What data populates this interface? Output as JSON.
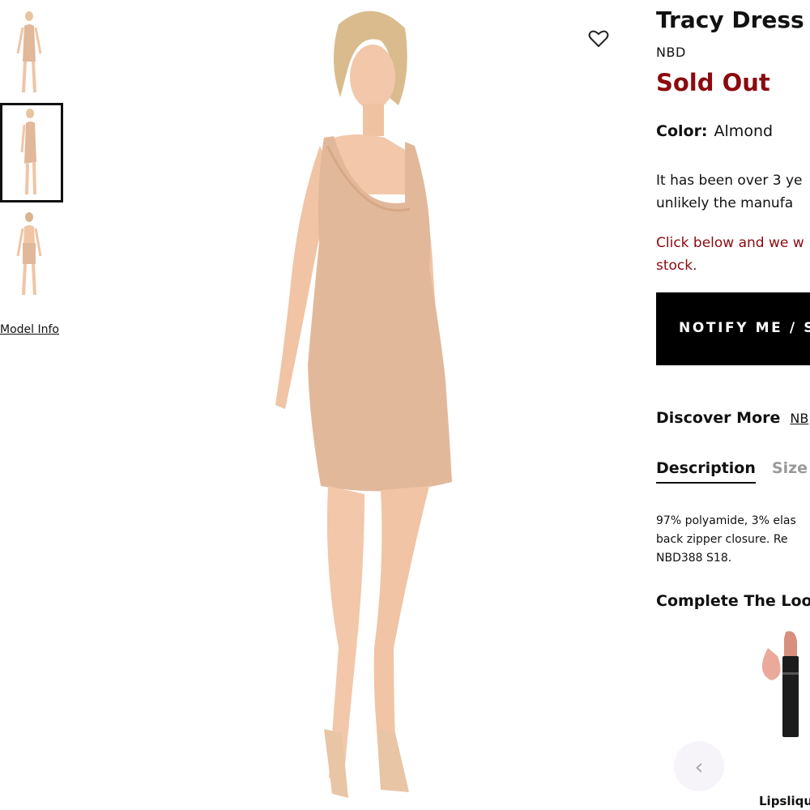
{
  "gallery": {
    "model_info_label": "Model Info"
  },
  "product": {
    "title": "Tracy Dress",
    "brand": "NBD",
    "status": "Sold Out",
    "color_label": "Color:",
    "color_value": "Almond",
    "notice_line1": "It has been over 3 ye",
    "notice_line2": "unlikely the manufa",
    "notice_red_line1": "Click below and we w",
    "notice_red_line2": "stock.",
    "notify_button": "NOTIFY ME / S",
    "discover_label": "Discover More",
    "discover_link": "NB",
    "tabs": [
      "Description",
      "Size"
    ],
    "description_line1": "97% polyamide, 3% elas",
    "description_line2": "back zipper closure. Re",
    "description_line3": "NBD388 S18.",
    "complete_look_label": "Complete The Loo",
    "complete_look_item": "Lipsliqu",
    "carousel_prev_icon": "‹"
  },
  "colors": {
    "sold_out": "#8b0a10",
    "button_bg": "#000000",
    "dress": "#e2b89a",
    "skin": "#f2c7aa"
  }
}
